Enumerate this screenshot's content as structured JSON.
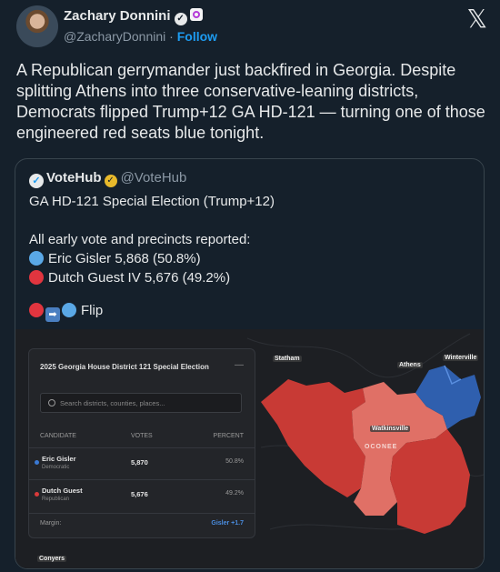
{
  "author": {
    "name": "Zachary Donnini",
    "handle": "@ZacharyDonnini",
    "separator": "·",
    "follow_label": "Follow"
  },
  "icons": {
    "x_logo": "𝕏",
    "verified": "✓",
    "arrow": "➡"
  },
  "tweet": {
    "text": "A Republican gerrymander just backfired in Georgia. Despite splitting Athens into three conservative-leaning districts, Democrats flipped Trump+12 GA HD-121 — turning one of those engineered red seats blue tonight."
  },
  "quote": {
    "name": "VoteHub",
    "handle": "@VoteHub",
    "line1": "GA HD-121 Special Election (Trump+12)",
    "line2": "All early vote and precincts reported:",
    "candidate1": "Eric Gisler 5,868 (50.8%)",
    "candidate2": "Dutch Guest IV 5,676 (49.2%)",
    "flip_label": "Flip"
  },
  "panel": {
    "title": "2025 Georgia House District 121 Special Election",
    "collapse": "—",
    "search_placeholder": "Search districts, counties, places...",
    "headers": {
      "candidate": "CANDIDATE",
      "votes": "VOTES",
      "percent": "PERCENT"
    },
    "rows": [
      {
        "name": "Eric Gisler",
        "party": "Democratic",
        "votes": "5,870",
        "percent": "50.8%",
        "color": "#3a79d4"
      },
      {
        "name": "Dutch Guest",
        "party": "Republican",
        "votes": "5,676",
        "percent": "49.2%",
        "color": "#d93a3a"
      }
    ],
    "margin_label": "Margin:",
    "margin_value": "Gisler +1.7"
  },
  "map": {
    "labels": {
      "statham": "Statham",
      "athens": "Athens",
      "winterville": "Winterville",
      "watkinsville": "Watkinsville",
      "oconee": "OCONEE",
      "conyers": "Conyers"
    },
    "colors": {
      "dem": "#2f5fae",
      "rep_dark": "#c83a35",
      "rep_light": "#e07066"
    }
  }
}
